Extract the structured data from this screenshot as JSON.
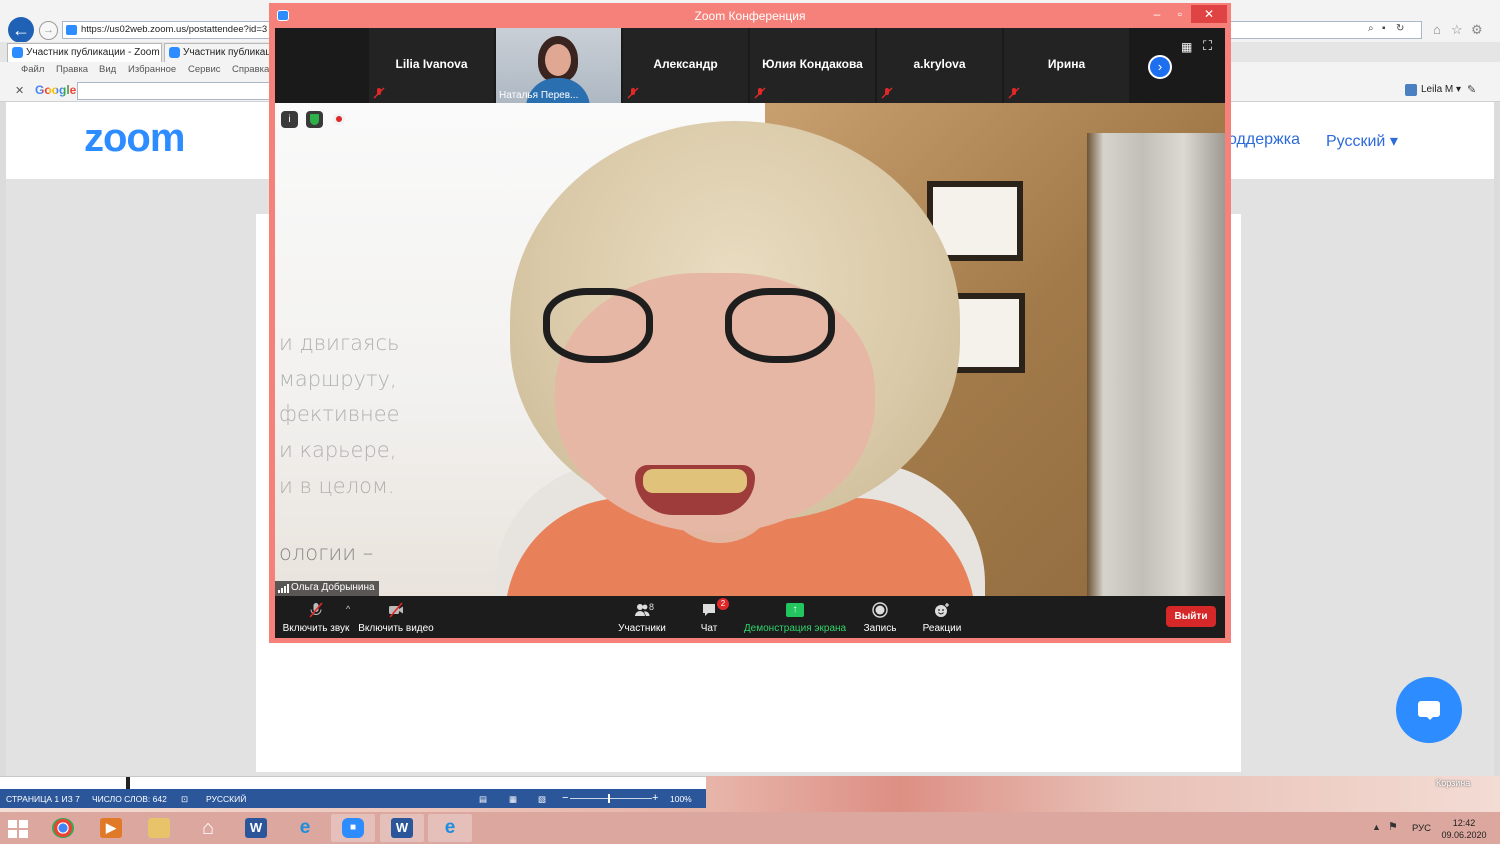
{
  "browser": {
    "address_url": "https://us02web.zoom.us/postattendee?id=3",
    "tabs": [
      "Участник публикации - Zoom",
      "Участник публикации"
    ],
    "menu": [
      "Файл",
      "Правка",
      "Вид",
      "Избранное",
      "Сервис",
      "Справка"
    ],
    "google_label": "Google",
    "user_label": "Leila M ▾"
  },
  "zoom_site": {
    "logo": "zoom",
    "nav_support": "оддержка",
    "nav_language": "Русский ▾"
  },
  "zoom_window": {
    "title": "Zoom Конференция",
    "participants_strip": [
      {
        "name": "Lilia Ivanova",
        "muted": true,
        "video": false
      },
      {
        "name": "Наталья Перев...",
        "muted": true,
        "video": true
      },
      {
        "name": "Александр",
        "muted": true,
        "video": false
      },
      {
        "name": "Юлия Кондакова",
        "muted": true,
        "video": false
      },
      {
        "name": "a.krylova",
        "muted": true,
        "video": false
      },
      {
        "name": "Ирина",
        "muted": true,
        "video": false
      }
    ],
    "speaker_name": "Ольга Добрынина",
    "poster_lines": [
      "и двигаясь",
      "маршруту,",
      "фективнее",
      "и карьере,",
      "и в целом.",
      "ологии –"
    ],
    "toolbar": {
      "unmute_label": "Включить звук",
      "video_label": "Включить видео",
      "participants_label": "Участники",
      "participants_count": "8",
      "chat_label": "Чат",
      "chat_badge": "2",
      "share_label": "Демонстрация экрана",
      "record_label": "Запись",
      "reactions_label": "Реакции",
      "leave_label": "Выйти"
    }
  },
  "word_status": {
    "page": "СТРАНИЦА 1 ИЗ 7",
    "words": "ЧИСЛО СЛОВ: 642",
    "language": "РУССКИЙ",
    "zoom_percent": "100%"
  },
  "desktop": {
    "trash_label": "Корзина"
  },
  "taskbar": {
    "apps": [
      "chrome",
      "media-player",
      "file-explorer",
      "home",
      "word",
      "internet-explorer",
      "zoom",
      "word",
      "internet-explorer"
    ],
    "language": "РУС",
    "time": "12:42",
    "date": "09.06.2020"
  },
  "colors": {
    "zoom_blue": "#2d8cff",
    "window_border": "#f5817a",
    "leave_red": "#d62828",
    "share_green": "#23c55e",
    "word_blue": "#2b579a"
  }
}
